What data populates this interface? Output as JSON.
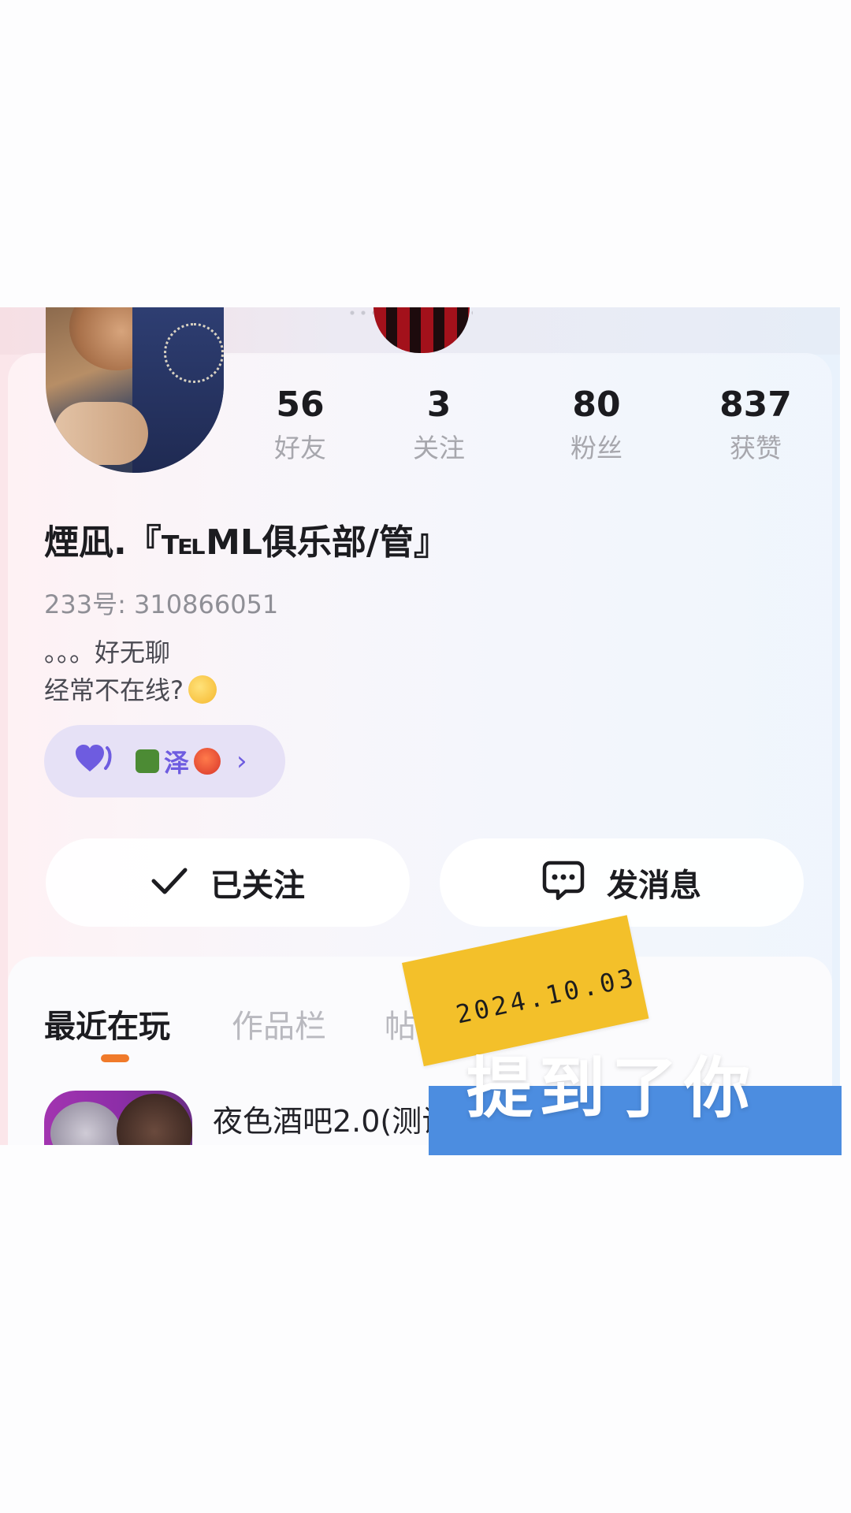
{
  "profile": {
    "nickname": "煙凪.『℡ML俱乐部/管』",
    "uid_label": "233号: 310866051",
    "bio_line1": "。。。好无聊",
    "bio_line2": "经常不在线?",
    "avatar_icon": "user-avatar"
  },
  "stats": [
    {
      "value": "56",
      "label": "好友"
    },
    {
      "value": "3",
      "label": "关注"
    },
    {
      "value": "80",
      "label": "粉丝"
    },
    {
      "value": "837",
      "label": "获赞"
    }
  ],
  "relation": {
    "name": "泽",
    "heart_icon": "heart-icon",
    "arrow": "›"
  },
  "actions": {
    "follow_label": "已关注",
    "message_label": "发消息"
  },
  "tabs": [
    "最近在玩",
    "作品栏",
    "帖"
  ],
  "recent_game": {
    "title": "夜色酒吧2.0(测试..."
  },
  "overlay": {
    "date": "2024.10.03",
    "mention": "提到了你"
  },
  "colors": {
    "accent_purple": "#6e5ce0",
    "tab_indicator": "#f07a2a",
    "mention_band": "#4c8de0",
    "date_tag": "#f3c02a"
  }
}
